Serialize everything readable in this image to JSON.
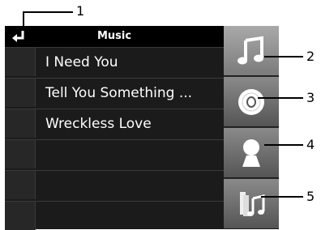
{
  "header": {
    "title": "Music"
  },
  "list": {
    "rows": [
      "I Need You",
      "Tell You Something ...",
      "Wreckless Love",
      "",
      "",
      ""
    ]
  },
  "tabs": [
    {
      "name": "music-note-icon",
      "active": true
    },
    {
      "name": "disc-icon",
      "active": false
    },
    {
      "name": "person-icon",
      "active": false
    },
    {
      "name": "playlist-icon",
      "active": false
    }
  ],
  "callouts": [
    "1",
    "2",
    "3",
    "4",
    "5"
  ]
}
